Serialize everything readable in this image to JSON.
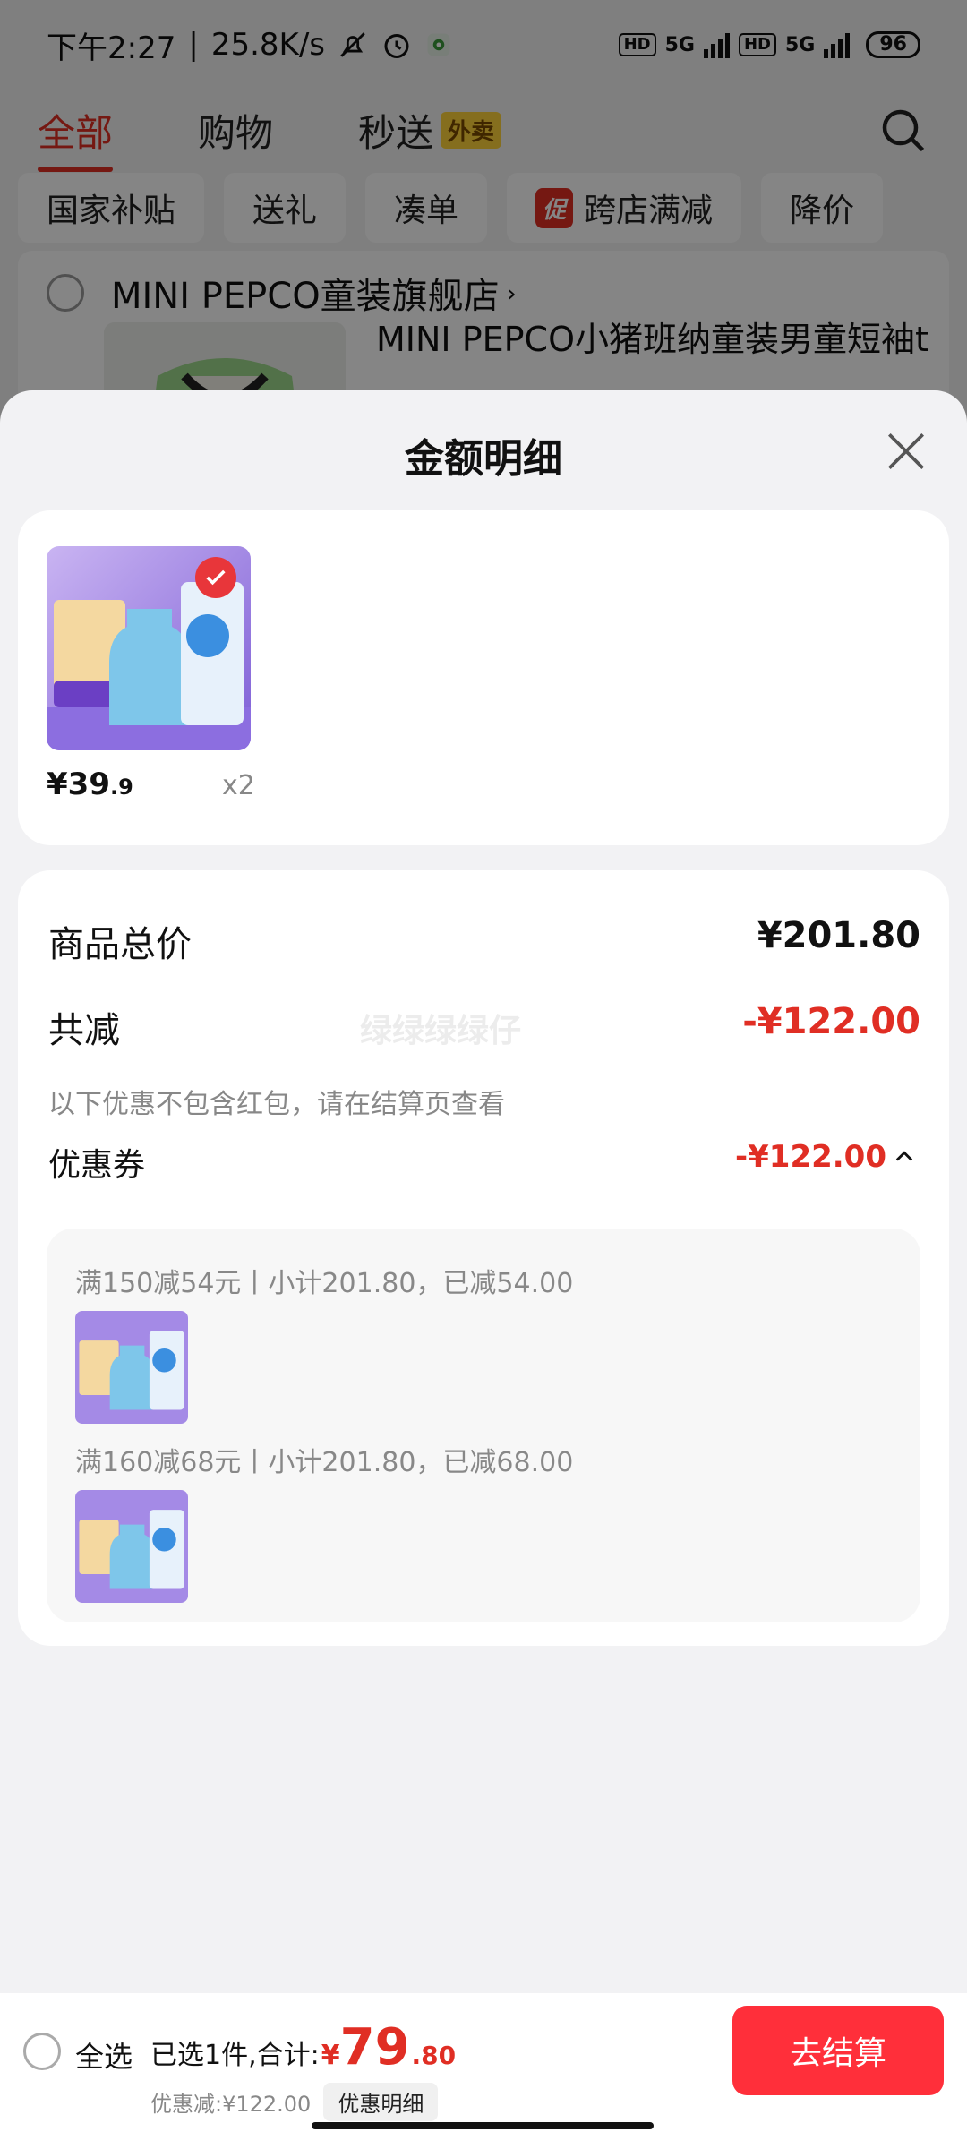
{
  "status_bar": {
    "time": "下午2:27",
    "speed": "25.8K/s",
    "hd1": "HD",
    "net1": "5G",
    "hd2": "HD",
    "net2": "5G",
    "battery": "96"
  },
  "top_tabs": [
    {
      "label": "全部"
    },
    {
      "label": "购物"
    },
    {
      "label": "秒送"
    }
  ],
  "top_tab_badge": "外卖",
  "filter_chips": [
    "国家补贴",
    "送礼",
    "凑单"
  ],
  "promo_chip": {
    "tag": "促",
    "label": "跨店满减"
  },
  "price_chip": "降价",
  "shop": {
    "name": "MINI PEPCO童装旗舰店",
    "item_title": "MINI PEPCO小猪班纳童装男童短袖t"
  },
  "sheet": {
    "title": "金额明细",
    "items": [
      {
        "price_int": "¥39",
        "price_dec": ".9",
        "qty": "x2"
      }
    ],
    "summary": {
      "total_label": "商品总价",
      "total_value": "¥201.80",
      "discount_label": "共减",
      "discount_value": "-¥122.00",
      "note": "以下优惠不包含红包，请在结算页查看",
      "watermark": "绿绿绿绿仔",
      "coupon_label": "优惠券",
      "coupon_value": "-¥122.00"
    },
    "coupons": [
      {
        "rule": "满150减54元丨小计201.80，已减54.00"
      },
      {
        "rule": "满160减68元丨小计201.80，已减68.00"
      }
    ]
  },
  "bottom_bar": {
    "select_all": "全选",
    "selected_text": "已选1件,合计:",
    "currency": "¥",
    "total_int": "79",
    "total_dec": ".80",
    "saved_text": "优惠减:¥122.00",
    "detail_button": "优惠明细",
    "checkout_button": "去结算"
  },
  "colors": {
    "accent_red": "#e02e24",
    "checkout_red": "#ff2f3a"
  }
}
